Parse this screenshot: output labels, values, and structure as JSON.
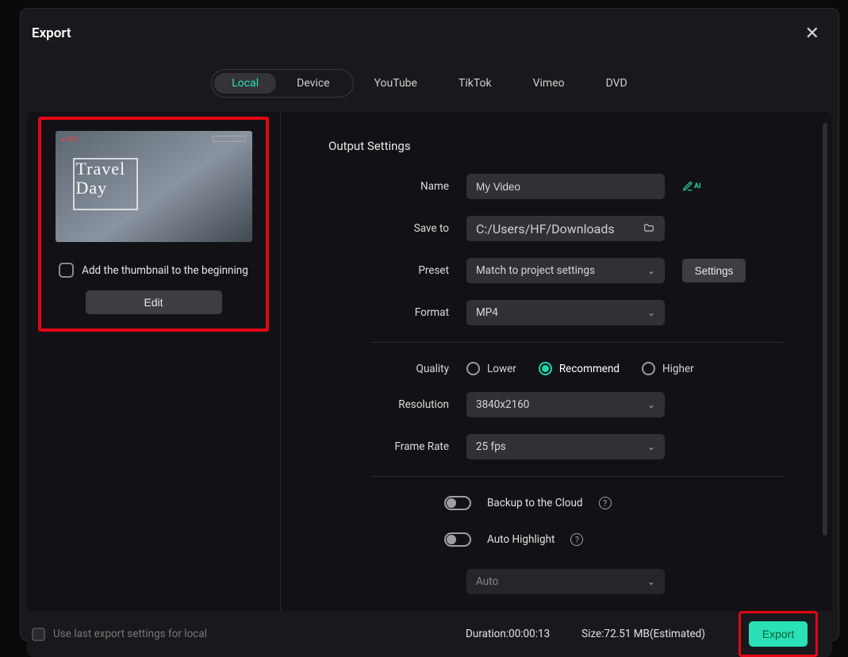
{
  "header": {
    "title": "Export"
  },
  "tabs": {
    "active": "Local",
    "items": [
      "Local",
      "Device",
      "YouTube",
      "TikTok",
      "Vimeo",
      "DVD"
    ]
  },
  "thumbnail": {
    "overlay_line1": "Travel",
    "overlay_line2": "Day",
    "checkbox_label": "Add the thumbnail to the beginning",
    "edit_label": "Edit"
  },
  "settings": {
    "section_title": "Output Settings",
    "name_label": "Name",
    "name_value": "My Video",
    "saveto_label": "Save to",
    "saveto_value": "C:/Users/HF/Downloads",
    "preset_label": "Preset",
    "preset_value": "Match to project settings",
    "settings_button": "Settings",
    "format_label": "Format",
    "format_value": "MP4",
    "quality_label": "Quality",
    "quality_options": {
      "lower": "Lower",
      "recommend": "Recommend",
      "higher": "Higher"
    },
    "resolution_label": "Resolution",
    "resolution_value": "3840x2160",
    "framerate_label": "Frame Rate",
    "framerate_value": "25 fps",
    "backup_label": "Backup to the Cloud",
    "highlight_label": "Auto Highlight",
    "auto_value": "Auto"
  },
  "footer": {
    "uselast_label": "Use last export settings for local",
    "duration_label": "Duration:",
    "duration_value": "00:00:13",
    "size_label": "Size:",
    "size_value": "72.51 MB",
    "size_suffix": "(Estimated)",
    "export_label": "Export"
  }
}
